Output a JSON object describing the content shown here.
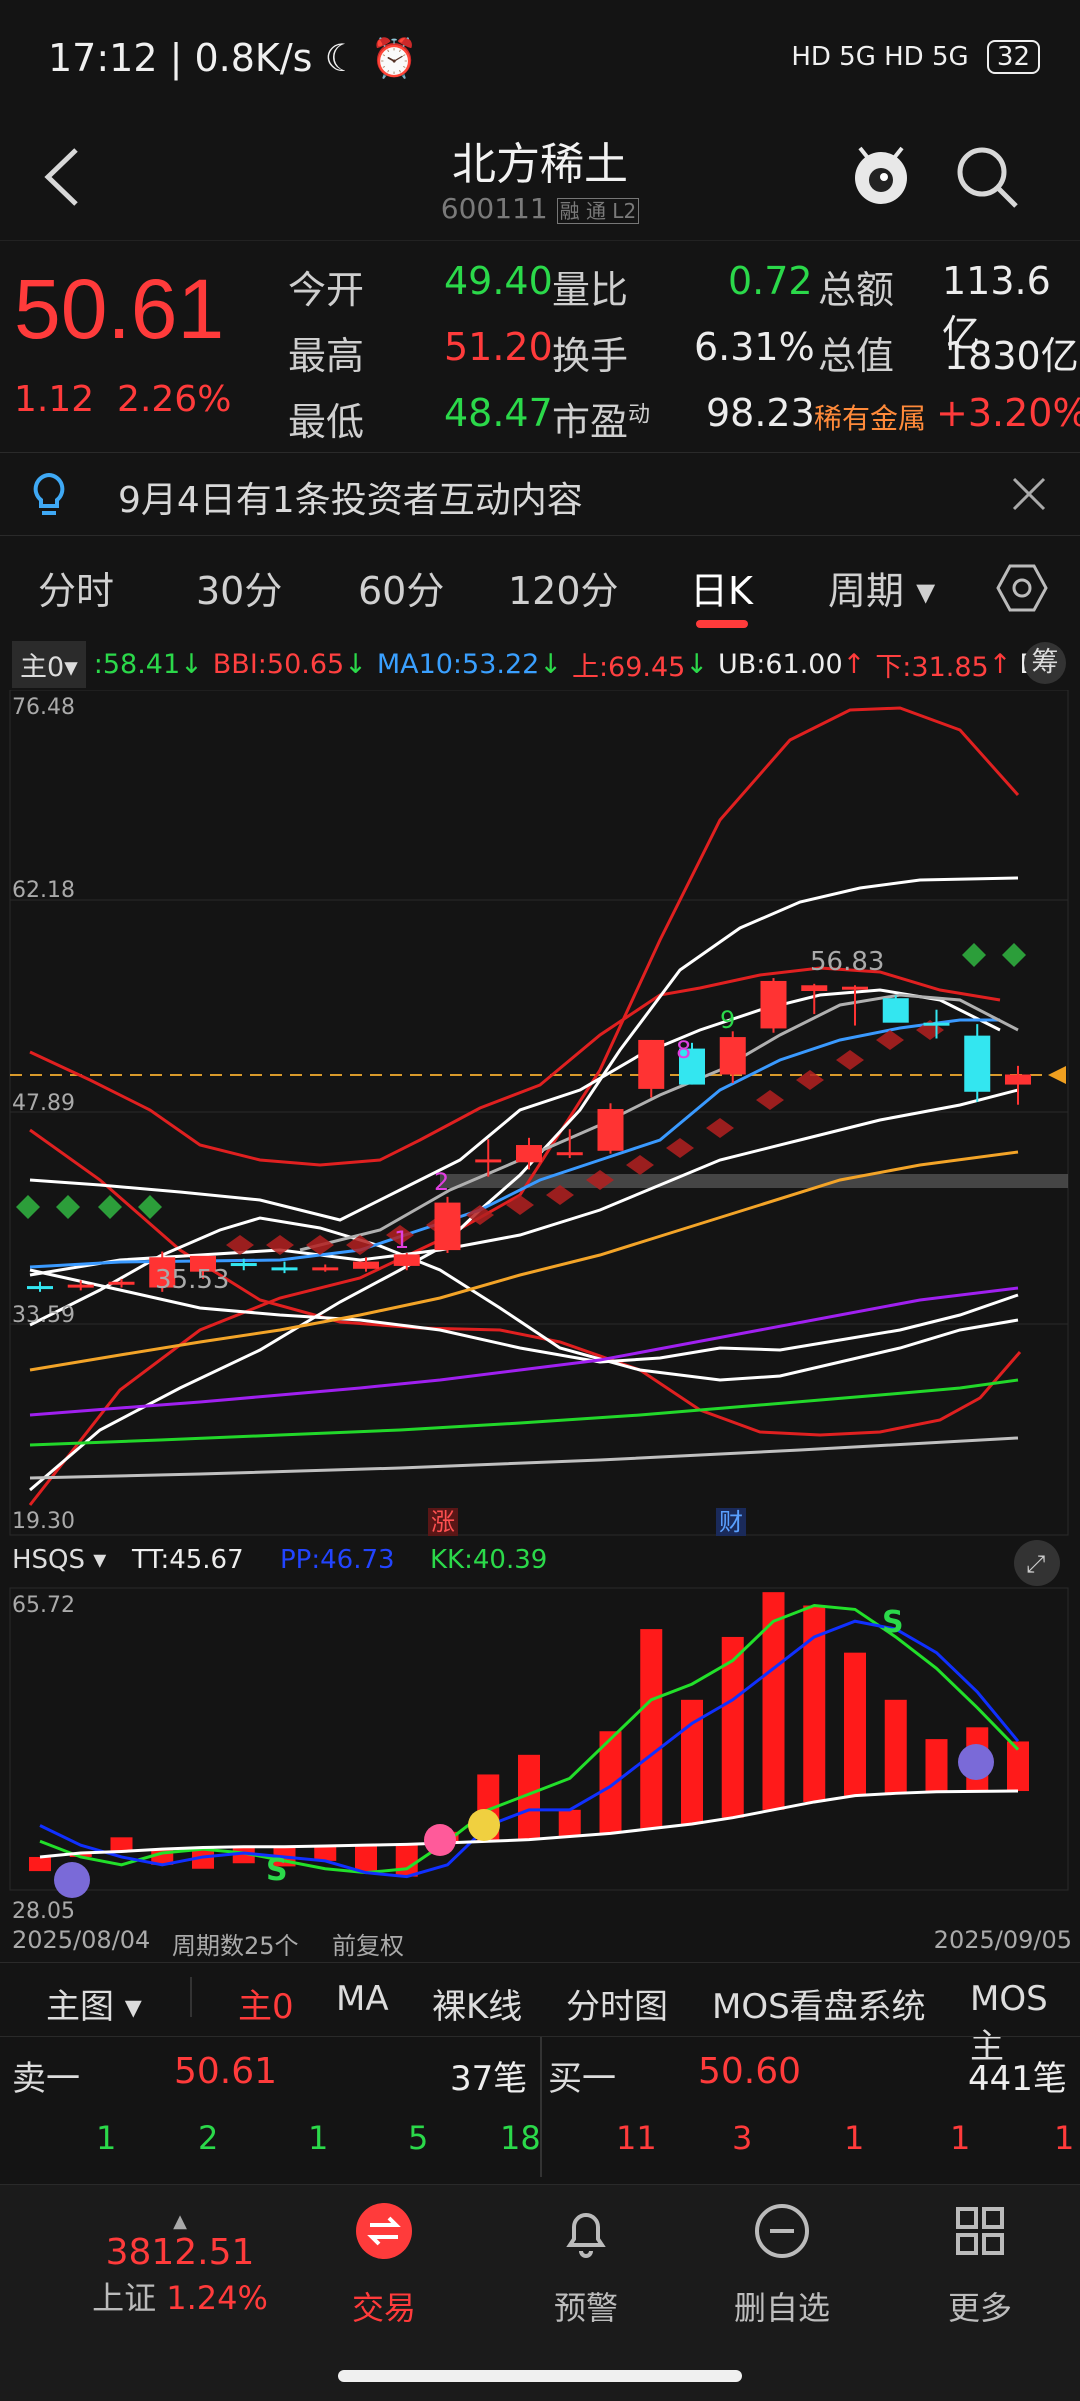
{
  "status_bar": {
    "time": "17:12",
    "speed": "0.8K/s",
    "network": "HD 5G HD 5G",
    "battery": "32"
  },
  "header": {
    "stock_name": "北方稀土",
    "stock_code": "600111",
    "tags": "融 通 L2"
  },
  "quote": {
    "price": "50.61",
    "change": "1.12",
    "change_pct": "2.26%",
    "open_label": "今开",
    "open": "49.40",
    "vol_ratio_label": "量比",
    "vol_ratio": "0.72",
    "amount_label": "总额",
    "amount": "113.6亿",
    "high_label": "最高",
    "high": "51.20",
    "turnover_label": "换手",
    "turnover": "6.31%",
    "mktcap_label": "总值",
    "mktcap": "1830亿",
    "low_label": "最低",
    "low": "48.47",
    "pe_label": "市盈",
    "pe_sup": "动",
    "pe": "98.23",
    "sector_label": "稀有金属",
    "sector_pct": "+3.20%"
  },
  "notice": {
    "text": "9月4日有1条投资者互动内容"
  },
  "tabs": [
    "分时",
    "30分",
    "60分",
    "120分",
    "日K",
    "周期"
  ],
  "active_tab": "日K",
  "indicators": {
    "main_label": "主0",
    "v1": ":58.41",
    "bbi": "BBI:50.65",
    "ma10": "MA10:53.22",
    "up": "上:69.45",
    "ub": "UB:61.00",
    "down": "下:31.85",
    "b": "B",
    "chip": "筹"
  },
  "main_axis": {
    "top": "76.48",
    "mid1": "62.18",
    "mid2": "47.89",
    "mid3": "33.59",
    "bottom": "19.30"
  },
  "chart_labels": {
    "peak": "56.83",
    "low": "35.53",
    "zhang": "涨",
    "cai": "财",
    "n1": "1",
    "n2": "2",
    "n8": "8",
    "n9": "9"
  },
  "sub_indicators": {
    "name": "HSQS",
    "tt": "TT:45.67",
    "pp": "PP:46.73",
    "kk": "KK:40.39",
    "top": "65.72",
    "bottom": "28.05",
    "s": "S"
  },
  "date_row": {
    "start": "2025/08/04",
    "count": "周期数25个",
    "adj": "前复权",
    "end": "2025/09/05"
  },
  "tool_row": [
    "主图",
    "主0",
    "MA",
    "裸K线",
    "分时图",
    "MOS看盘系统",
    "MOS主"
  ],
  "orderbook": {
    "sell_label": "卖一",
    "sell_price": "50.61",
    "sell_count": "37笔",
    "buy_label": "买一",
    "buy_price": "50.60",
    "buy_count": "441笔",
    "sell_queue": [
      "1",
      "2",
      "1",
      "5",
      "18"
    ],
    "buy_queue": [
      "11",
      "3",
      "1",
      "1",
      "1"
    ]
  },
  "bottom_nav": {
    "index_value": "3812.51",
    "index_name": "上证",
    "index_pct": "1.24%",
    "trade": "交易",
    "alert": "预警",
    "remove": "删自选",
    "more": "更多"
  },
  "chart_data": {
    "type": "candlestick",
    "x_start": "2025/08/04",
    "x_end": "2025/09/05",
    "ylim": [
      19.3,
      76.48
    ],
    "candles": [
      {
        "o": 35.9,
        "h": 36.2,
        "l": 35.5,
        "c": 35.8
      },
      {
        "o": 35.8,
        "h": 36.3,
        "l": 35.6,
        "c": 36.0
      },
      {
        "o": 36.0,
        "h": 36.4,
        "l": 35.8,
        "c": 36.2
      },
      {
        "o": 35.8,
        "h": 38.3,
        "l": 35.5,
        "c": 37.9
      },
      {
        "o": 36.9,
        "h": 37.6,
        "l": 36.4,
        "c": 38.0
      },
      {
        "o": 37.5,
        "h": 37.8,
        "l": 37.0,
        "c": 37.4
      },
      {
        "o": 37.2,
        "h": 37.6,
        "l": 36.8,
        "c": 37.0
      },
      {
        "o": 37.1,
        "h": 37.4,
        "l": 36.9,
        "c": 37.2
      },
      {
        "o": 37.1,
        "h": 37.9,
        "l": 36.9,
        "c": 37.6
      },
      {
        "o": 37.3,
        "h": 38.2,
        "l": 37.0,
        "c": 38.1
      },
      {
        "o": 38.4,
        "h": 42.1,
        "l": 38.2,
        "c": 41.7
      },
      {
        "o": 44.5,
        "h": 46.1,
        "l": 43.5,
        "c": 44.7
      },
      {
        "o": 44.5,
        "h": 46.2,
        "l": 44.0,
        "c": 45.7
      },
      {
        "o": 45.0,
        "h": 46.8,
        "l": 44.8,
        "c": 45.2
      },
      {
        "o": 45.3,
        "h": 48.6,
        "l": 45.1,
        "c": 48.2
      },
      {
        "o": 49.6,
        "h": 53.0,
        "l": 49.0,
        "c": 53.0
      },
      {
        "o": 52.4,
        "h": 52.8,
        "l": 49.9,
        "c": 49.9
      },
      {
        "o": 50.6,
        "h": 53.6,
        "l": 50.0,
        "c": 53.2
      },
      {
        "o": 53.8,
        "h": 57.3,
        "l": 53.5,
        "c": 57.1
      },
      {
        "o": 56.4,
        "h": 56.9,
        "l": 54.8,
        "c": 56.8
      },
      {
        "o": 56.6,
        "h": 56.8,
        "l": 54.0,
        "c": 56.7
      },
      {
        "o": 55.9,
        "h": 56.1,
        "l": 54.3,
        "c": 54.2
      },
      {
        "o": 54.2,
        "h": 55.1,
        "l": 53.1,
        "c": 54.1
      },
      {
        "o": 53.3,
        "h": 54.1,
        "l": 48.7,
        "c": 49.4
      },
      {
        "o": 49.9,
        "h": 51.2,
        "l": 48.5,
        "c": 50.6
      }
    ],
    "sub_bars": [
      30.2,
      32.0,
      34.5,
      31.0,
      30.5,
      31.2,
      30.8,
      31.5,
      30.0,
      29.5,
      35.2,
      42.5,
      45.0,
      38.0,
      48.0,
      61.0,
      52.0,
      60.0,
      65.7,
      64.0,
      58.0,
      52.0,
      47.0,
      48.5,
      46.7
    ],
    "sub_tt": [
      34.0,
      32.0,
      31.0,
      32.5,
      33.0,
      32.5,
      31.5,
      30.5,
      30.0,
      30.5,
      34.0,
      38.0,
      40.0,
      42.0,
      47.0,
      52.0,
      54.0,
      57.0,
      62.0,
      64.0,
      63.5,
      60.0,
      56.0,
      51.0,
      45.67
    ],
    "sub_pp": [
      36.0,
      33.5,
      32.0,
      31.0,
      32.0,
      32.5,
      32.0,
      31.5,
      30.0,
      29.5,
      31.0,
      36.0,
      38.0,
      38.0,
      41.0,
      45.0,
      49.0,
      52.0,
      56.0,
      60.0,
      62.0,
      61.0,
      58.0,
      53.0,
      46.73
    ],
    "sub_kk": [
      32.0,
      32.5,
      32.7,
      33.0,
      33.2,
      33.3,
      33.3,
      33.4,
      33.5,
      33.6,
      33.8,
      34.0,
      34.2,
      34.6,
      35.0,
      35.6,
      36.2,
      37.0,
      38.0,
      39.0,
      39.8,
      40.1,
      40.3,
      40.35,
      40.39
    ]
  },
  "colors": {
    "up": "#ff3333",
    "down": "#33e6f0",
    "bg": "#141414",
    "accent": "#ff3b3b"
  }
}
